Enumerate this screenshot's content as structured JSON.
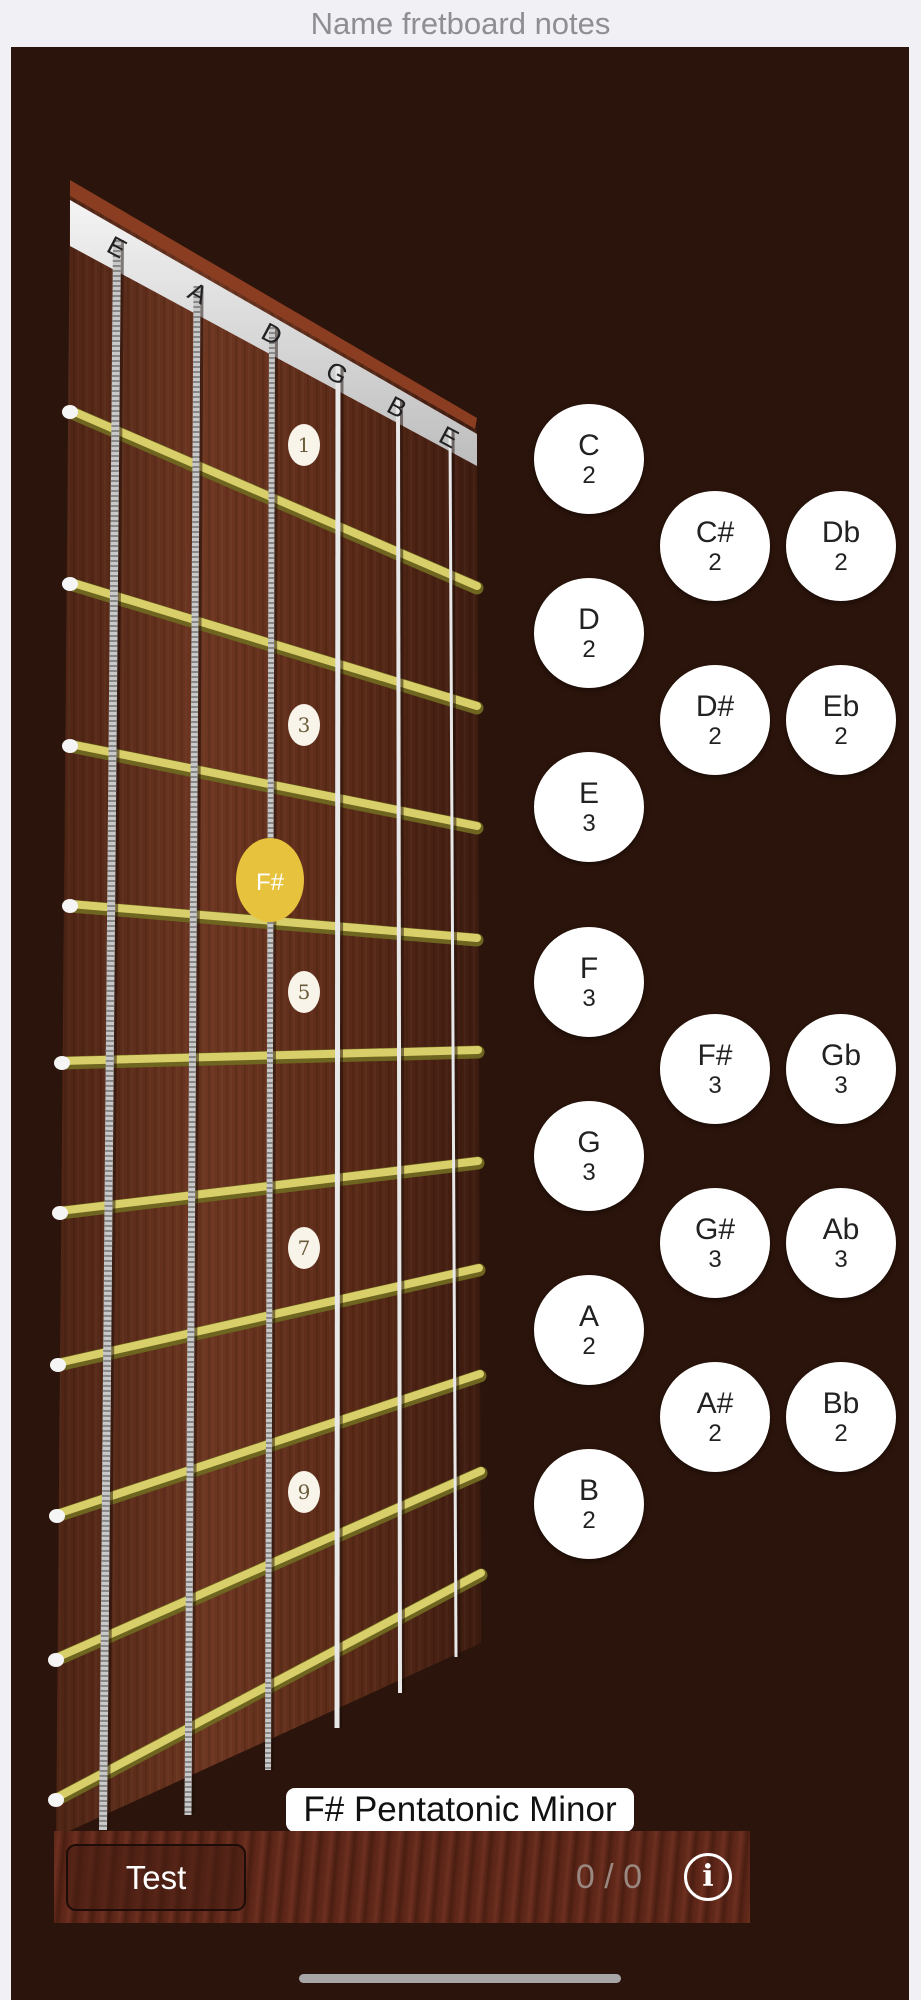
{
  "header": {
    "title": "Name fretboard notes"
  },
  "fretboard": {
    "strings": [
      "E",
      "A",
      "D",
      "G",
      "B",
      "E"
    ],
    "inlays": [
      "1",
      "3",
      "5",
      "7",
      "9"
    ],
    "highlighted_note": "F#",
    "colors": {
      "background": "#2b140b",
      "wood": "#6a3420",
      "fret": "#d8cf6a",
      "highlight": "#e7c23d"
    }
  },
  "notes": [
    {
      "name": "C",
      "count": "2"
    },
    {
      "name": "C#",
      "count": "2"
    },
    {
      "name": "Db",
      "count": "2"
    },
    {
      "name": "D",
      "count": "2"
    },
    {
      "name": "D#",
      "count": "2"
    },
    {
      "name": "Eb",
      "count": "2"
    },
    {
      "name": "E",
      "count": "3"
    },
    {
      "name": "F",
      "count": "3"
    },
    {
      "name": "F#",
      "count": "3"
    },
    {
      "name": "Gb",
      "count": "3"
    },
    {
      "name": "G",
      "count": "3"
    },
    {
      "name": "G#",
      "count": "3"
    },
    {
      "name": "Ab",
      "count": "3"
    },
    {
      "name": "A",
      "count": "2"
    },
    {
      "name": "A#",
      "count": "2"
    },
    {
      "name": "Bb",
      "count": "2"
    },
    {
      "name": "B",
      "count": "2"
    }
  ],
  "scale_label": "F# Pentatonic Minor",
  "bottom_bar": {
    "test_label": "Test",
    "score": "0 / 0",
    "info_icon": "info-icon",
    "info_glyph": "i"
  }
}
